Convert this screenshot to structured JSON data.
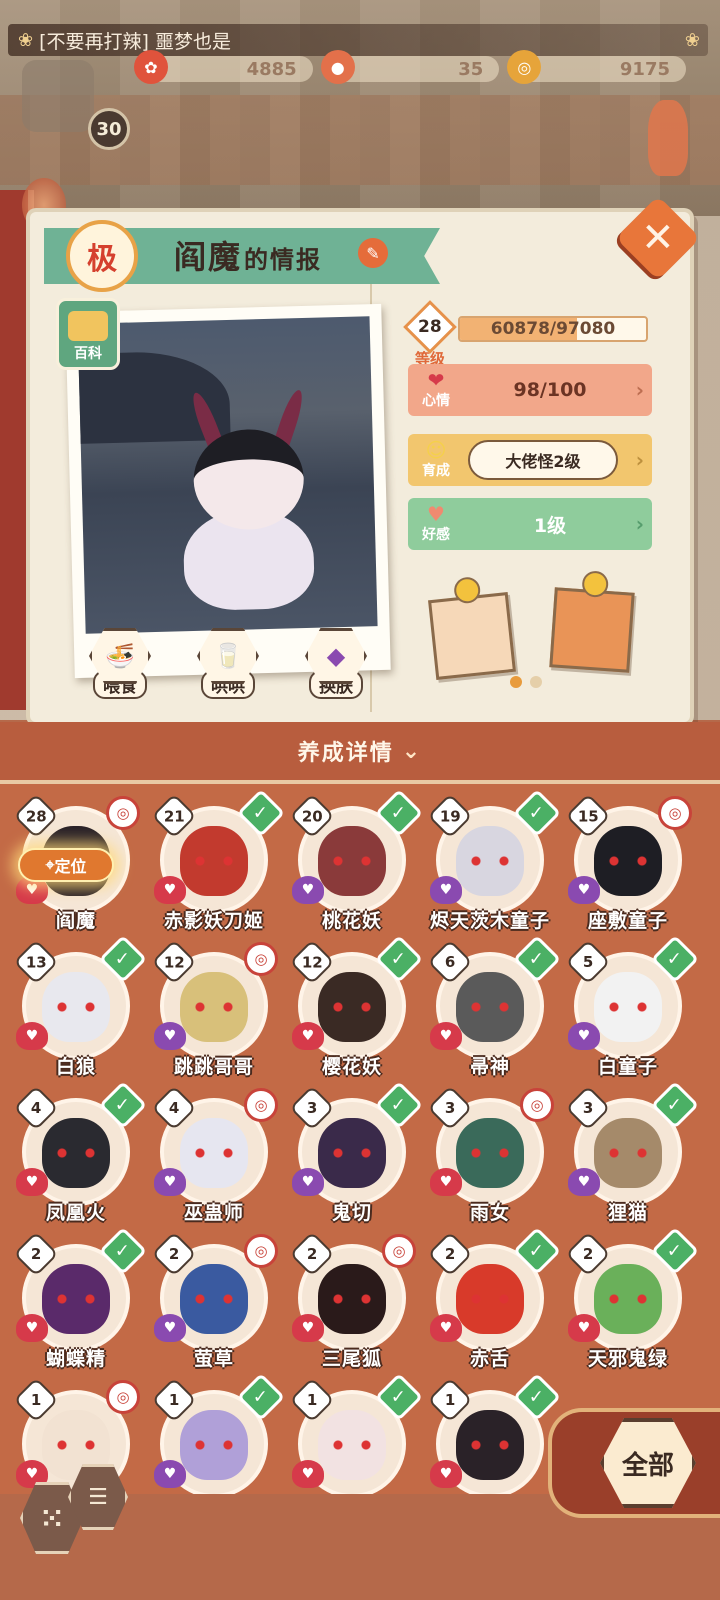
{
  "header": {
    "message": "[不要再打辣] 噩梦也是",
    "resources": [
      "4885",
      "35",
      "9175"
    ],
    "player_level": "30"
  },
  "panel": {
    "rank": "极",
    "name": "阎魔",
    "name_suffix": "的情报",
    "wiki_label": "百科",
    "level": "28",
    "level_label": "等级",
    "exp_text": "60878/97080",
    "exp_fraction": 0.627,
    "mood_label": "心情",
    "mood_value": "98/100",
    "grow_label": "育成",
    "grow_value": "大佬怪2级",
    "favor_label": "好感",
    "favor_value": "1级",
    "actions": [
      "喂食",
      "哄哄",
      "换肤"
    ]
  },
  "detail_title": "养成详情",
  "locate_label": "定位",
  "all_label": "全部",
  "colors": {
    "heart_red": "#d63a4a",
    "heart_purple": "#8a4ab0",
    "check_green": "#4bb065"
  },
  "cards": [
    {
      "level": "28",
      "name": "阎魔",
      "badge": "other",
      "heart": "red"
    },
    {
      "level": "21",
      "name": "赤影妖刀姬",
      "badge": "check",
      "heart": "red"
    },
    {
      "level": "20",
      "name": "桃花妖",
      "badge": "check",
      "heart": "purple"
    },
    {
      "level": "19",
      "name": "烬天茨木童子",
      "badge": "check",
      "heart": "purple"
    },
    {
      "level": "15",
      "name": "座敷童子",
      "badge": "other",
      "heart": "purple"
    },
    {
      "level": "13",
      "name": "白狼",
      "badge": "check",
      "heart": "red"
    },
    {
      "level": "12",
      "name": "跳跳哥哥",
      "badge": "other",
      "heart": "purple"
    },
    {
      "level": "12",
      "name": "樱花妖",
      "badge": "check",
      "heart": "red"
    },
    {
      "level": "6",
      "name": "帚神",
      "badge": "check",
      "heart": "red"
    },
    {
      "level": "5",
      "name": "白童子",
      "badge": "check",
      "heart": "purple"
    },
    {
      "level": "4",
      "name": "凤凰火",
      "badge": "check",
      "heart": "red"
    },
    {
      "level": "4",
      "name": "巫蛊师",
      "badge": "other",
      "heart": "purple"
    },
    {
      "level": "3",
      "name": "鬼切",
      "badge": "check",
      "heart": "purple"
    },
    {
      "level": "3",
      "name": "雨女",
      "badge": "other",
      "heart": "red"
    },
    {
      "level": "3",
      "name": "狸猫",
      "badge": "check",
      "heart": "purple"
    },
    {
      "level": "2",
      "name": "蝴蝶精",
      "badge": "check",
      "heart": "red"
    },
    {
      "level": "2",
      "name": "萤草",
      "badge": "other",
      "heart": "purple"
    },
    {
      "level": "2",
      "name": "三尾狐",
      "badge": "other",
      "heart": "red"
    },
    {
      "level": "2",
      "name": "赤舌",
      "badge": "check",
      "heart": "red"
    },
    {
      "level": "2",
      "name": "天邪鬼绿",
      "badge": "check",
      "heart": "red"
    },
    {
      "level": "1",
      "name": "",
      "badge": "other",
      "heart": "red"
    },
    {
      "level": "1",
      "name": "",
      "badge": "check",
      "heart": "purple"
    },
    {
      "level": "1",
      "name": "",
      "badge": "check",
      "heart": "red"
    },
    {
      "level": "1",
      "name": "",
      "badge": "check",
      "heart": "red"
    }
  ]
}
